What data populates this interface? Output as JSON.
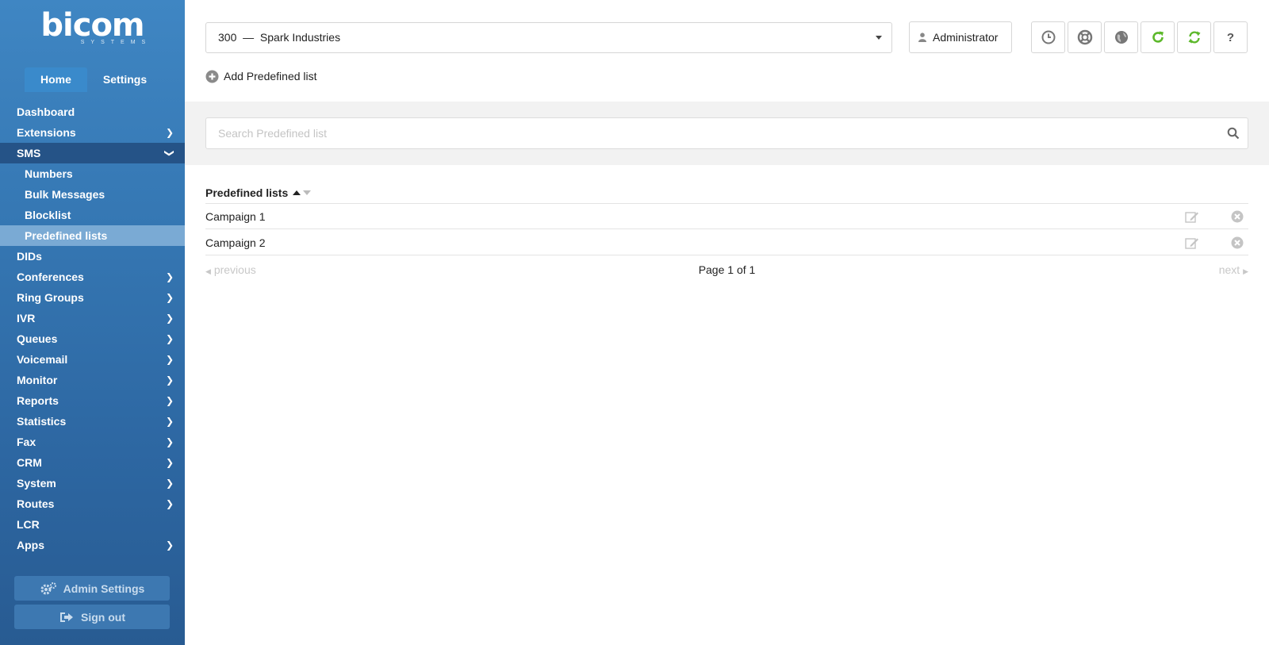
{
  "sidebar": {
    "logo": {
      "word": "bicom",
      "sub": "SYSTEMS"
    },
    "tabs": [
      {
        "label": "Home"
      },
      {
        "label": "Settings"
      }
    ],
    "items": [
      {
        "label": "Dashboard"
      },
      {
        "label": "Extensions"
      },
      {
        "label": "SMS"
      },
      {
        "label": "Numbers"
      },
      {
        "label": "Bulk Messages"
      },
      {
        "label": "Blocklist"
      },
      {
        "label": "Predefined lists"
      },
      {
        "label": "DIDs"
      },
      {
        "label": "Conferences"
      },
      {
        "label": "Ring Groups"
      },
      {
        "label": "IVR"
      },
      {
        "label": "Queues"
      },
      {
        "label": "Voicemail"
      },
      {
        "label": "Monitor"
      },
      {
        "label": "Reports"
      },
      {
        "label": "Statistics"
      },
      {
        "label": "Fax"
      },
      {
        "label": "CRM"
      },
      {
        "label": "System"
      },
      {
        "label": "Routes"
      },
      {
        "label": "LCR"
      },
      {
        "label": "Apps"
      }
    ],
    "admin_settings_label": "Admin Settings",
    "sign_out_label": "Sign out"
  },
  "header": {
    "tenant_value": "300  —  Spark Industries",
    "user_label": "Administrator",
    "icons": [
      "clock-icon",
      "lifebuoy-icon",
      "globe-icon",
      "reload-icon",
      "sync-icon",
      "help-icon"
    ],
    "help_glyph": "?",
    "accent_green": "#5cb82a"
  },
  "toolbar": {
    "add_label": "Add Predefined list"
  },
  "search": {
    "placeholder": "Search Predefined list"
  },
  "table": {
    "header": "Predefined lists",
    "rows": [
      {
        "name": "Campaign 1"
      },
      {
        "name": "Campaign 2"
      }
    ]
  },
  "pagination": {
    "prev": "previous",
    "info": "Page 1 of 1",
    "next": "next"
  }
}
